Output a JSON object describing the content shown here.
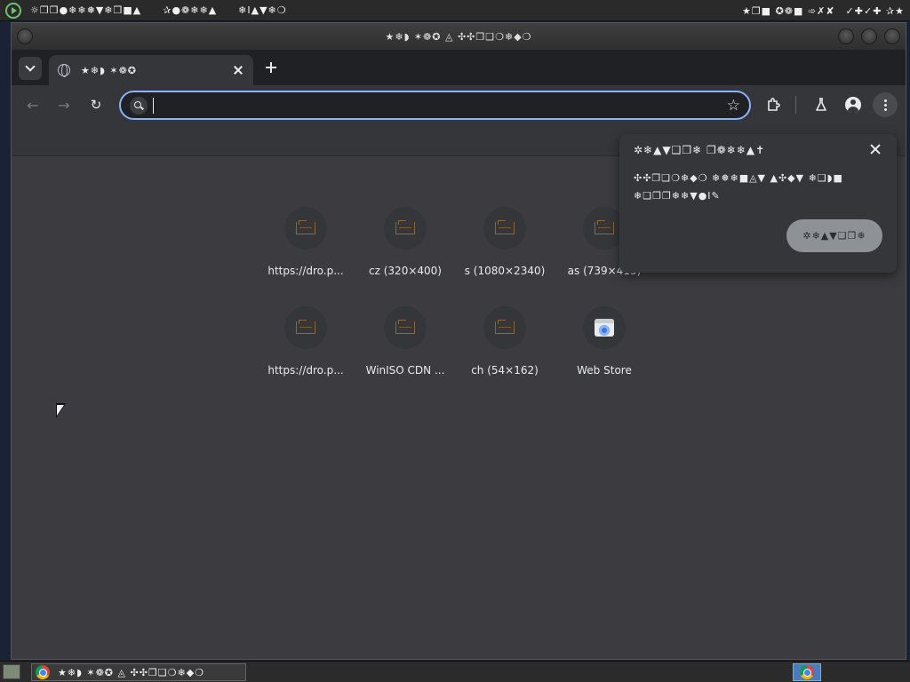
{
  "top_panel": {
    "menus": [
      "☼❐❒●❄❄❅▼❄❒■▲",
      "✰●❁❄❄▲",
      "❄I▲▼❄❍"
    ],
    "right_items": [
      "★❐■ ✪❁■ ➾✗✘",
      "✓✚✓✚ ✰★"
    ]
  },
  "window": {
    "title": "★❄◗ ✶❁✪ ◬ ✣✣❐❑❍❄◆❍"
  },
  "tab": {
    "title": "★❄◗ ✶❁✪"
  },
  "toolbar": {
    "omnibox_value": "",
    "omnibox_placeholder": ""
  },
  "popup": {
    "title": "✲❄▲▼❑❐❄ ❐❁❄❄▲✝",
    "body_line1": "✣✣❐❑❍❄◆❍ ❄❅❄■◬▼ ▲✣◆▼ ❄❑◗■",
    "body_line2": "❄❑❐❐❄❄▼●I✎",
    "button_label": "✲❄▲▼❑❐❄"
  },
  "shortcuts": [
    {
      "label": "https://dro.p...",
      "icon": "folder-icon"
    },
    {
      "label": "cz (320×400)",
      "icon": "folder-icon"
    },
    {
      "label": "s (1080×2340)",
      "icon": "folder-icon"
    },
    {
      "label": "as (739×415)",
      "icon": "folder-icon"
    },
    {
      "label": "https://dro.p...",
      "icon": "folder-icon"
    },
    {
      "label": "WinISO CDN ...",
      "icon": "folder-icon"
    },
    {
      "label": "ch (54×162)",
      "icon": "folder-icon"
    },
    {
      "label": "Web Store",
      "icon": "web-store-icon"
    }
  ],
  "taskbar": {
    "window_label": "★❄◗ ✶❁✪ ◬ ✣✣❐❑❍❄◆❍"
  },
  "colors": {
    "omnibox_focus": "#8ab4f8",
    "page_background": "#3c3c40",
    "toolbar": "#35363a"
  }
}
